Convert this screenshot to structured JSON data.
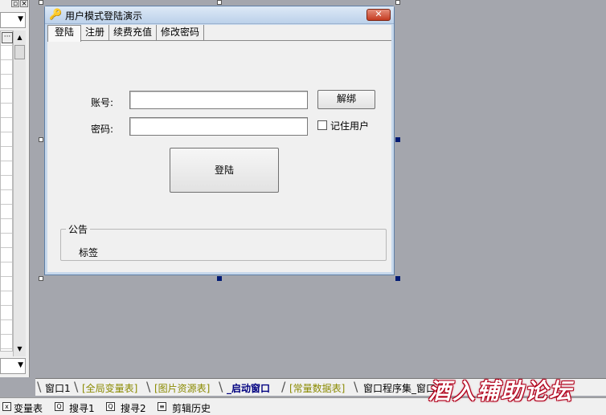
{
  "window": {
    "title": "用户模式登陆演示",
    "close_glyph": "✕"
  },
  "tabs": [
    {
      "label": "登陆"
    },
    {
      "label": "注册"
    },
    {
      "label": "续费充值"
    },
    {
      "label": "修改密码"
    }
  ],
  "form": {
    "account_label": "账号:",
    "account_value": "",
    "password_label": "密码:",
    "password_value": "",
    "unbind_label": "解绑",
    "remember_label": "记住用户",
    "remember_checked": false,
    "login_label": "登陆"
  },
  "notice": {
    "legend": "公告",
    "text": "标签"
  },
  "bottom_tabs": [
    {
      "label": "窗口1",
      "color": "#000000"
    },
    {
      "label": "[全局变量表]",
      "color": "#8a8a00"
    },
    {
      "label": "[图片资源表]",
      "color": "#8a8a00"
    },
    {
      "label": "_启动窗口",
      "color": "#000080"
    },
    {
      "label": "[常量数据表]",
      "color": "#8a8a00"
    },
    {
      "label": "窗口程序集_窗口",
      "color": "#000000"
    }
  ],
  "status_tabs": [
    {
      "label": "变量表",
      "icon": "variable-icon"
    },
    {
      "label": "搜寻1",
      "icon": "search-icon"
    },
    {
      "label": "搜寻2",
      "icon": "search-icon"
    },
    {
      "label": "剪辑历史",
      "icon": "clipboard-icon"
    }
  ],
  "watermark": "酒入辅助论坛",
  "colors": {
    "desktop": "#a4a6ad",
    "title_gradient_top": "#dde9f6",
    "close_button": "#c43b21",
    "selection_handle": "#001a73",
    "watermark_outline": "#b0001a"
  }
}
